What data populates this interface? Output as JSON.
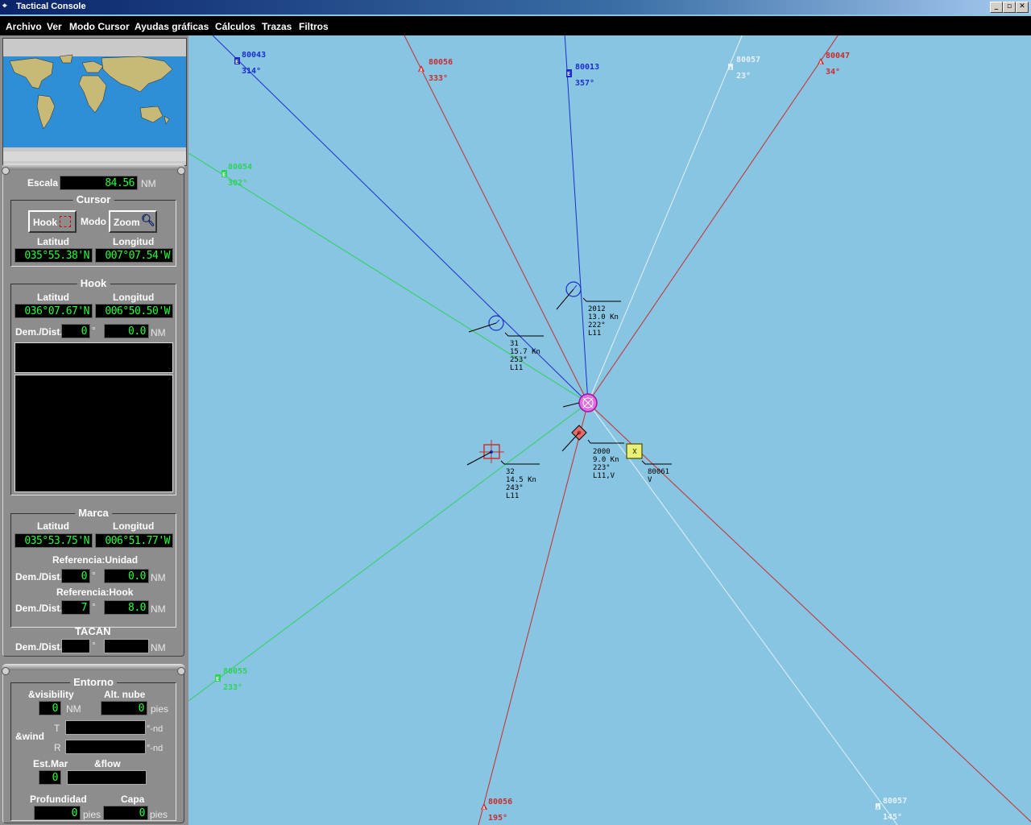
{
  "window": {
    "title": "Tactical Console",
    "buttons": [
      "_",
      "▫",
      "✕"
    ]
  },
  "menu": [
    "Archivo",
    "Ver",
    "Modo Cursor",
    "Ayudas gráficas",
    "Cálculos",
    "Trazas",
    "Filtros"
  ],
  "escala": {
    "label": "Escala",
    "value": "84.56",
    "unit": "NM"
  },
  "cursor": {
    "title": "Cursor",
    "hook_button": "Hook",
    "modo_label": "Modo",
    "zoom_button": "Zoom",
    "lat_label": "Latitud",
    "lon_label": "Longitud",
    "lat": "035°55.38'N",
    "lon": "007°07.54'W"
  },
  "hook": {
    "title": "Hook",
    "lat_label": "Latitud",
    "lon_label": "Longitud",
    "lat": "036°07.67'N",
    "lon": "006°50.50'W",
    "dem_label": "Dem./Dist.",
    "dem": "0",
    "deg": "°",
    "dist": "0.0",
    "unit": "NM"
  },
  "marca": {
    "title": "Marca",
    "lat_label": "Latitud",
    "lon_label": "Longitud",
    "lat": "035°53.75'N",
    "lon": "006°51.77'W",
    "ref_unidad_label": "Referencia:Unidad",
    "dem_label": "Dem./Dist.",
    "unidad_dem": "0",
    "unidad_dist": "0.0",
    "ref_hook_label": "Referencia:Hook",
    "hook_dem": "7",
    "hook_dist": "8.0",
    "deg": "°",
    "unit": "NM"
  },
  "tacan": {
    "title": "TACAN",
    "dem_label": "Dem./Dist.",
    "deg": "°",
    "unit": "NM"
  },
  "entorno": {
    "title": "Entorno",
    "visibility_label": "&visibility",
    "visibility": "0",
    "nm": "NM",
    "cloud_label": "Alt. nube",
    "cloud": "0",
    "pies": "pies",
    "wind_label": "&wind",
    "t_label": "T",
    "r_label": "R",
    "nd": "°-nd",
    "estmar_label": "Est.Mar",
    "estmar": "0",
    "flow_label": "&flow",
    "prof_label": "Profundidad",
    "prof": "0",
    "capa_label": "Capa",
    "capa": "0"
  },
  "map": {
    "colors": {
      "sea": "#87c5e3",
      "blue": "#1c2ccc",
      "red": "#cc2a2a",
      "green": "#2fd15a",
      "white": "#e6f1f8",
      "magenta": "#c61fc6"
    },
    "edge_labels": [
      {
        "id": "80043",
        "bearing": "314°",
        "color": "blue",
        "sym": "E"
      },
      {
        "id": "80056",
        "bearing": "333°",
        "color": "red",
        "sym": "A"
      },
      {
        "id": "80013",
        "bearing": "357°",
        "color": "blue",
        "sym": "E"
      },
      {
        "id": "80057",
        "bearing": "23°",
        "color": "white",
        "sym": "A"
      },
      {
        "id": "80047",
        "bearing": "34°",
        "color": "red",
        "sym": "A"
      },
      {
        "id": "80054",
        "bearing": "302°",
        "color": "green",
        "sym": "E"
      },
      {
        "id": "80055",
        "bearing": "233°",
        "color": "green",
        "sym": "E"
      },
      {
        "id": "80056",
        "bearing": "195°",
        "color": "red",
        "sym": "A"
      },
      {
        "id": "80057",
        "bearing": "145°",
        "color": "white",
        "sym": "A"
      }
    ],
    "tracks": [
      {
        "lines": [
          "2012",
          "13.0 Kn",
          "222°",
          "L11"
        ]
      },
      {
        "lines": [
          "31",
          "15.7 Kn",
          "253°",
          "L11"
        ]
      },
      {
        "lines": [
          "32",
          "14.5 Kn",
          "243°",
          "L11"
        ]
      },
      {
        "lines": [
          "2000",
          "9.0 Kn",
          "223°",
          "L11,V"
        ]
      },
      {
        "lines": [
          "80061",
          "V"
        ]
      }
    ]
  }
}
